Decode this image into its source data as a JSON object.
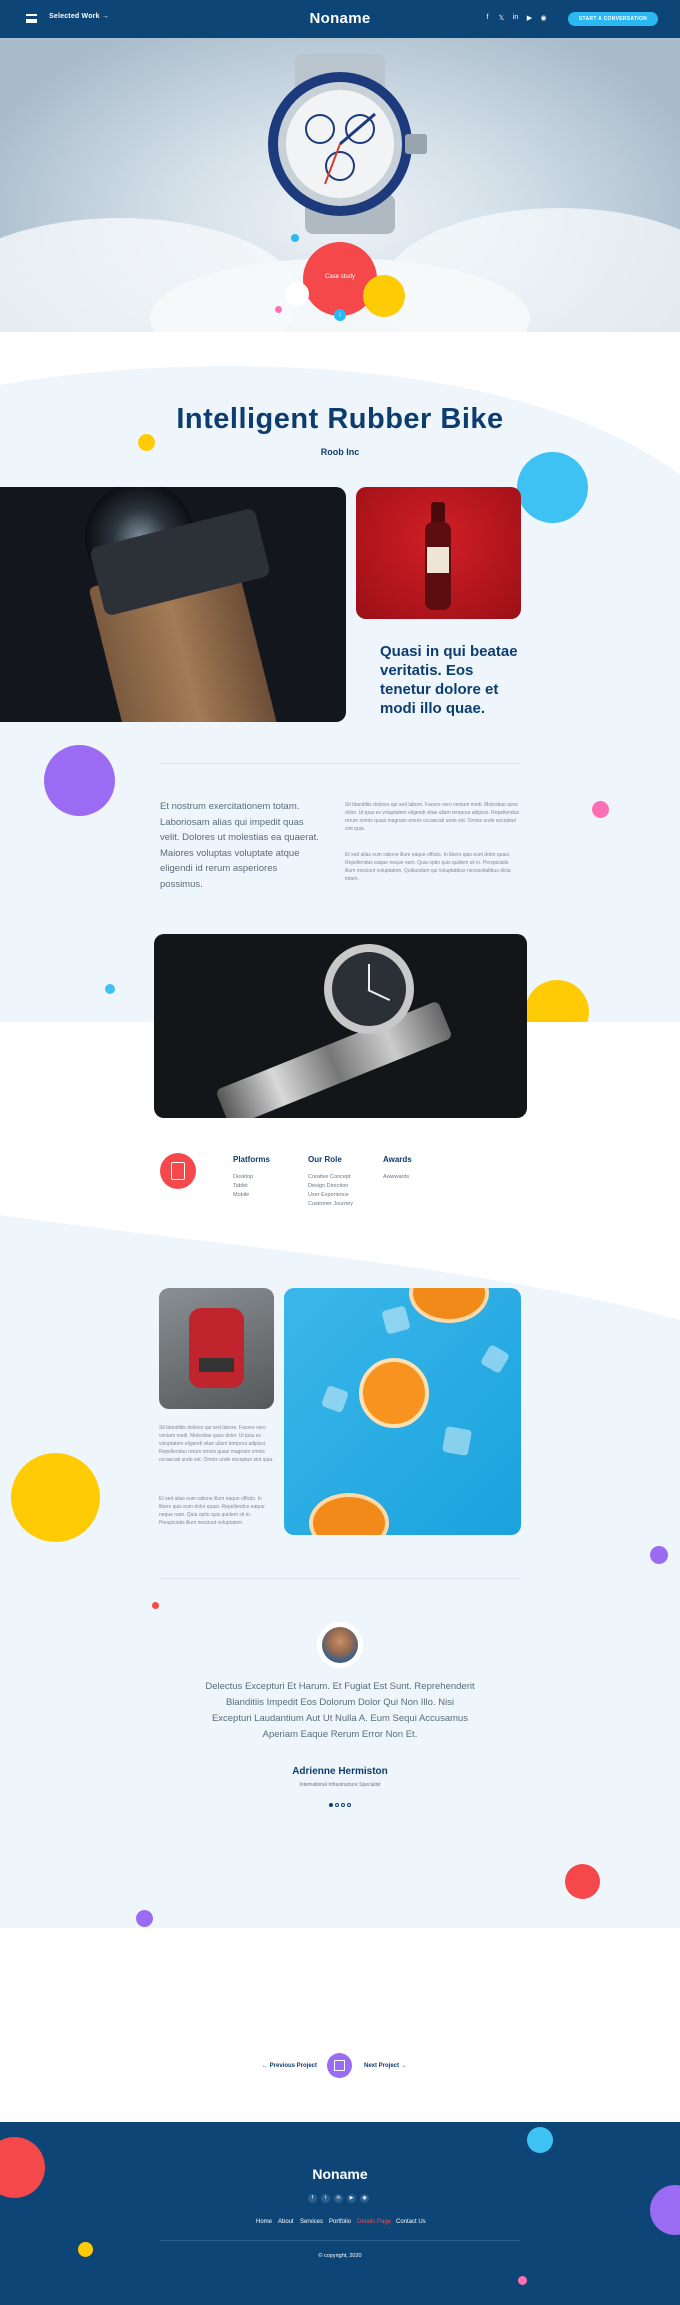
{
  "header": {
    "selected_work": "Selected Work →",
    "logo": "Noname",
    "cta": "START A CONVERSATION",
    "social_icons": [
      "facebook-icon",
      "twitter-icon",
      "linkedin-icon",
      "youtube-icon",
      "dribbble-icon"
    ]
  },
  "hero": {
    "badge": "Case study"
  },
  "project": {
    "title": "Intelligent Rubber Bike",
    "client": "Roob Inc",
    "quote": "Quasi in qui beatae veritatis. Eos tenetur dolore et modi illo quae.",
    "lead": "Et nostrum exercitationem totam. Laboriosam alias qui impedit quas velit. Dolores ut molestias ea quaerat. Maiores voluptas voluptate atque eligendi id rerum asperiores possimus.",
    "para1": "Sit blanditiis dolores qui sed labore. Facere vero veniam modi. Molestiae quos dolor. Ut ipsa ex voluptatem eligendi vitae ullam tempora adipisci. Repellendus rerum omnis quasi magnam omnis occaecati unde est. Omnis unde excepturi sint quia.",
    "para2": "Et sed alias eum ratione illum eaque officiis. In libero quis eum dolor quasi. Repellendus eaque neque nam. Quia optio quis quidem sit in. Perspiciatis illum nesciunt voluptatem. Quibusdam qui voluptatibus necessitatibus dicta totam."
  },
  "details": {
    "platforms": {
      "heading": "Platforms",
      "items": [
        "Desktop",
        "Tablet",
        "Mobile"
      ]
    },
    "role": {
      "heading": "Our Role",
      "items": [
        "Creative Concept",
        "Design Direction",
        "User Experience",
        "Customer Journey"
      ]
    },
    "awards": {
      "heading": "Awards",
      "items": [
        "Awwwards"
      ]
    }
  },
  "gallery_text": {
    "para1": "Sit blanditiis dolores qui sed labore. Facere vero veniam modi. Molestiae quos dolor. Ut ipsa ex voluptatem eligendi vitae ullam tempora adipisci. Repellendus rerum omnis quasi magnam omnis occaecati unde est. Omnis unde excepturi sint quia.",
    "para2": "Et sed alias eum ratione illum eaque officiis. In libero quis eum dolor quasi. Repellendus eaque neque nam. Quia optio quis quidem sit in. Perspiciatis illum nesciunt voluptatem."
  },
  "testimonial": {
    "quote": "Delectus Excepturi Et Harum. Et Fugiat Est Sunt. Reprehenderit Blanditiis Impedit Eos Dolorum Dolor Qui Non Illo. Nisi Excepturi Laudantium Aut Ut Nulla A. Eum Sequi Accusamus Aperiam Eaque Rerum Error Non Et.",
    "name": "Adrienne Hermiston",
    "role": "International Infrastructure Specialist"
  },
  "pager": {
    "prev": "← Previous Project",
    "next": "Next Project →"
  },
  "footer": {
    "logo": "Noname",
    "links": [
      "Home",
      "About",
      "Services",
      "Portfolio",
      "Details Page",
      "Contact Us"
    ],
    "copyright": "© copyright, 2020"
  },
  "colors": {
    "navy": "#0d4577",
    "accent_blue": "#2ab8f2",
    "red": "#f5484b",
    "yellow": "#ffcb05",
    "purple": "#9b6cf3",
    "pink": "#ff6fb4"
  }
}
